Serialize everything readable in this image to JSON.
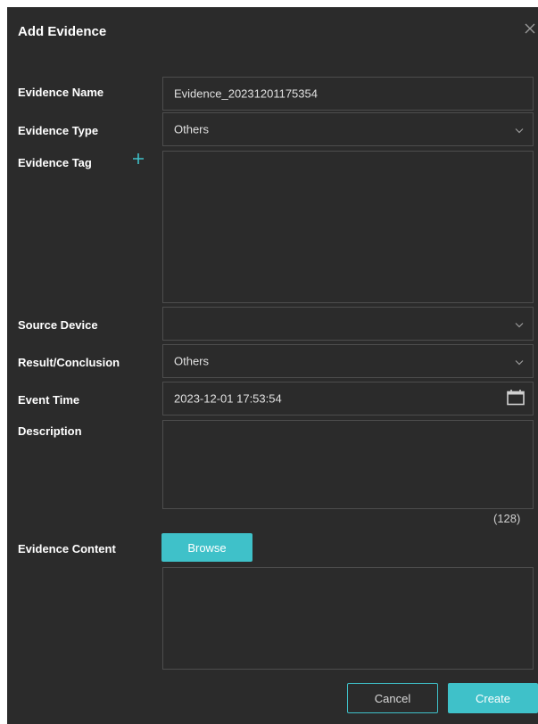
{
  "dialog": {
    "title": "Add Evidence",
    "close_icon": "close-icon"
  },
  "fields": {
    "evidence_name": {
      "label": "Evidence Name",
      "value": "Evidence_20231201175354"
    },
    "evidence_type": {
      "label": "Evidence Type",
      "value": "Others",
      "icon": "chevron-down-icon"
    },
    "evidence_tag": {
      "label": "Evidence Tag",
      "add_icon": "plus-icon"
    },
    "source_device": {
      "label": "Source Device",
      "value": "",
      "icon": "chevron-down-icon"
    },
    "result_conclusion": {
      "label": "Result/Conclusion",
      "value": "Others",
      "icon": "chevron-down-icon"
    },
    "event_time": {
      "label": "Event Time",
      "value": "2023-12-01 17:53:54",
      "icon": "calendar-icon"
    },
    "description": {
      "label": "Description",
      "value": "",
      "counter": "(128)"
    },
    "evidence_content": {
      "label": "Evidence Content",
      "browse_label": "Browse"
    }
  },
  "actions": {
    "cancel_label": "Cancel",
    "create_label": "Create"
  },
  "colors": {
    "background": "#2b2b2b",
    "border": "#4d4d4d",
    "accent": "#3fc1c9",
    "text": "#e6e6e6"
  }
}
